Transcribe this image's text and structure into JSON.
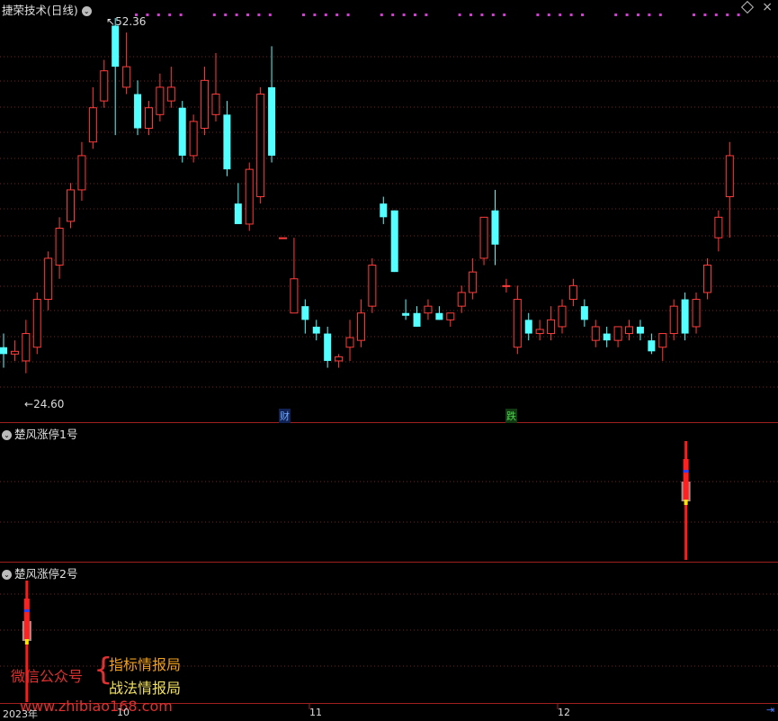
{
  "main_panel": {
    "title": "捷荣技术(日线)",
    "high_label": "52.36",
    "low_label": "24.60",
    "markers": [
      {
        "text": "财",
        "color": "#6fa8ff",
        "bg": "#1a2a5a"
      },
      {
        "text": "跌",
        "color": "#4cd24c",
        "bg": "#1a3a1a"
      }
    ]
  },
  "sub_panel_1": {
    "title": "楚风涨停1号"
  },
  "sub_panel_2": {
    "title": "楚风涨停2号"
  },
  "x_axis": {
    "labels": [
      "2023年",
      "10",
      "11",
      "12"
    ]
  },
  "watermark": {
    "wechat_label": "微信公众号",
    "line1": "指标情报局",
    "line2": "战法情报局",
    "url": "www.zhibiao168.com"
  },
  "colors": {
    "up": "#ff3c3c",
    "down": "#54ffff",
    "grid": "#7a1f1f",
    "separator": "#a02020"
  },
  "chart_data": {
    "type": "candlestick",
    "price_range": [
      24.6,
      52.36
    ],
    "candles": [
      {
        "o": 28.3,
        "h": 29.3,
        "l": 26.8,
        "c": 27.8
      },
      {
        "o": 27.8,
        "h": 28.8,
        "l": 27.3,
        "c": 28.0
      },
      {
        "o": 27.3,
        "h": 30.3,
        "l": 26.4,
        "c": 29.3
      },
      {
        "o": 28.3,
        "h": 32.3,
        "l": 27.8,
        "c": 31.8
      },
      {
        "o": 31.8,
        "h": 35.3,
        "l": 31.0,
        "c": 34.8
      },
      {
        "o": 34.3,
        "h": 37.8,
        "l": 33.3,
        "c": 37.0
      },
      {
        "o": 37.5,
        "h": 40.3,
        "l": 37.0,
        "c": 39.8
      },
      {
        "o": 39.8,
        "h": 43.3,
        "l": 39.0,
        "c": 42.3
      },
      {
        "o": 43.3,
        "h": 47.3,
        "l": 42.8,
        "c": 45.8
      },
      {
        "o": 46.3,
        "h": 49.3,
        "l": 45.8,
        "c": 48.5
      },
      {
        "o": 51.8,
        "h": 52.36,
        "l": 43.8,
        "c": 48.8
      },
      {
        "o": 47.3,
        "h": 51.3,
        "l": 46.8,
        "c": 48.8
      },
      {
        "o": 46.8,
        "h": 47.8,
        "l": 43.8,
        "c": 44.3
      },
      {
        "o": 44.3,
        "h": 46.3,
        "l": 43.8,
        "c": 45.8
      },
      {
        "o": 45.3,
        "h": 48.3,
        "l": 44.8,
        "c": 47.3
      },
      {
        "o": 46.3,
        "h": 48.8,
        "l": 45.8,
        "c": 47.3
      },
      {
        "o": 45.8,
        "h": 46.3,
        "l": 41.8,
        "c": 42.3
      },
      {
        "o": 42.3,
        "h": 45.3,
        "l": 41.8,
        "c": 44.8
      },
      {
        "o": 44.3,
        "h": 48.8,
        "l": 43.8,
        "c": 47.8
      },
      {
        "o": 45.3,
        "h": 49.8,
        "l": 44.8,
        "c": 46.8
      },
      {
        "o": 45.3,
        "h": 46.3,
        "l": 40.8,
        "c": 41.3
      },
      {
        "o": 38.8,
        "h": 40.3,
        "l": 37.3,
        "c": 37.3
      },
      {
        "o": 37.3,
        "h": 41.8,
        "l": 36.8,
        "c": 41.3
      },
      {
        "o": 39.3,
        "h": 47.3,
        "l": 38.8,
        "c": 46.8
      },
      {
        "o": 47.3,
        "h": 50.3,
        "l": 41.8,
        "c": 42.3
      },
      {
        "o": 36.3,
        "h": 36.3,
        "l": 36.3,
        "c": 36.3
      },
      {
        "o": 30.8,
        "h": 36.3,
        "l": 30.8,
        "c": 33.3
      },
      {
        "o": 31.3,
        "h": 31.8,
        "l": 29.3,
        "c": 30.3
      },
      {
        "o": 29.8,
        "h": 30.3,
        "l": 28.8,
        "c": 29.3
      },
      {
        "o": 29.3,
        "h": 29.8,
        "l": 26.8,
        "c": 27.3
      },
      {
        "o": 27.3,
        "h": 27.8,
        "l": 26.8,
        "c": 27.6
      },
      {
        "o": 28.3,
        "h": 30.3,
        "l": 27.3,
        "c": 29.0
      },
      {
        "o": 28.8,
        "h": 31.8,
        "l": 28.3,
        "c": 30.8
      },
      {
        "o": 31.3,
        "h": 34.8,
        "l": 30.8,
        "c": 34.3
      },
      {
        "o": 38.8,
        "h": 39.3,
        "l": 37.3,
        "c": 37.8
      },
      {
        "o": 38.3,
        "h": 38.3,
        "l": 33.8,
        "c": 33.8
      },
      {
        "o": 30.8,
        "h": 31.8,
        "l": 30.3,
        "c": 30.6
      },
      {
        "o": 30.8,
        "h": 31.3,
        "l": 29.8,
        "c": 29.8
      },
      {
        "o": 30.8,
        "h": 31.8,
        "l": 30.3,
        "c": 31.3
      },
      {
        "o": 30.8,
        "h": 31.3,
        "l": 30.3,
        "c": 30.3
      },
      {
        "o": 30.3,
        "h": 30.8,
        "l": 29.8,
        "c": 30.8
      },
      {
        "o": 31.3,
        "h": 32.8,
        "l": 30.8,
        "c": 32.3
      },
      {
        "o": 32.3,
        "h": 34.8,
        "l": 31.8,
        "c": 33.8
      },
      {
        "o": 34.8,
        "h": 37.8,
        "l": 34.3,
        "c": 37.8
      },
      {
        "o": 38.3,
        "h": 39.8,
        "l": 34.3,
        "c": 35.8
      },
      {
        "o": 32.8,
        "h": 33.3,
        "l": 32.3,
        "c": 32.8
      },
      {
        "o": 28.3,
        "h": 32.8,
        "l": 27.8,
        "c": 31.8
      },
      {
        "o": 30.3,
        "h": 30.8,
        "l": 28.8,
        "c": 29.3
      },
      {
        "o": 29.3,
        "h": 30.3,
        "l": 28.8,
        "c": 29.6
      },
      {
        "o": 29.3,
        "h": 31.3,
        "l": 28.8,
        "c": 30.3
      },
      {
        "o": 29.8,
        "h": 31.8,
        "l": 29.3,
        "c": 31.3
      },
      {
        "o": 31.8,
        "h": 33.3,
        "l": 31.3,
        "c": 32.8
      },
      {
        "o": 31.3,
        "h": 31.8,
        "l": 29.8,
        "c": 30.3
      },
      {
        "o": 28.8,
        "h": 30.3,
        "l": 28.3,
        "c": 29.8
      },
      {
        "o": 29.3,
        "h": 29.8,
        "l": 28.3,
        "c": 28.8
      },
      {
        "o": 28.8,
        "h": 29.8,
        "l": 28.3,
        "c": 29.8
      },
      {
        "o": 29.3,
        "h": 30.3,
        "l": 28.8,
        "c": 29.8
      },
      {
        "o": 29.8,
        "h": 30.3,
        "l": 28.8,
        "c": 29.3
      },
      {
        "o": 28.8,
        "h": 29.3,
        "l": 27.8,
        "c": 28.0
      },
      {
        "o": 28.3,
        "h": 29.3,
        "l": 27.3,
        "c": 29.3
      },
      {
        "o": 29.3,
        "h": 31.8,
        "l": 28.8,
        "c": 31.3
      },
      {
        "o": 31.8,
        "h": 32.3,
        "l": 28.8,
        "c": 29.3
      },
      {
        "o": 29.8,
        "h": 32.3,
        "l": 29.3,
        "c": 31.8
      },
      {
        "o": 32.3,
        "h": 34.8,
        "l": 31.8,
        "c": 34.3
      },
      {
        "o": 36.3,
        "h": 38.3,
        "l": 35.3,
        "c": 37.8
      },
      {
        "o": 39.3,
        "h": 43.3,
        "l": 36.3,
        "c": 42.3
      }
    ],
    "signal_1": {
      "bar_index": 61
    },
    "signal_2": {
      "bar_index": 2
    }
  }
}
